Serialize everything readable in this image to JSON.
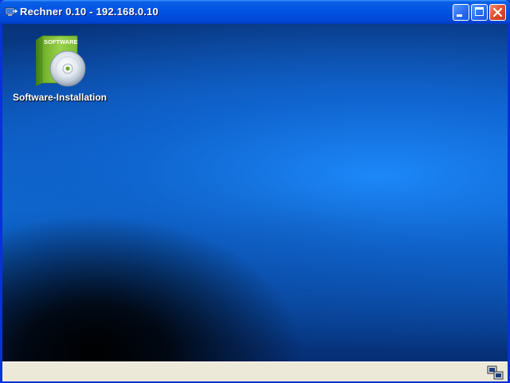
{
  "window": {
    "title": "Rechner 0.10 - 192.168.0.10",
    "app_icon": "remote-desktop-icon",
    "buttons": {
      "minimize": "minimize-icon",
      "maximize": "maximize-icon",
      "close": "close-icon"
    }
  },
  "desktop": {
    "icons": [
      {
        "label": "Software-Installation",
        "icon": "software-box-cd-icon",
        "box_text": "SOFTWARE"
      }
    ]
  },
  "statusbar": {
    "icon": "monitor-icon"
  },
  "colors": {
    "titlebar": "#0255e3",
    "close_button": "#e04a2a",
    "statusbar": "#ece9d8"
  }
}
